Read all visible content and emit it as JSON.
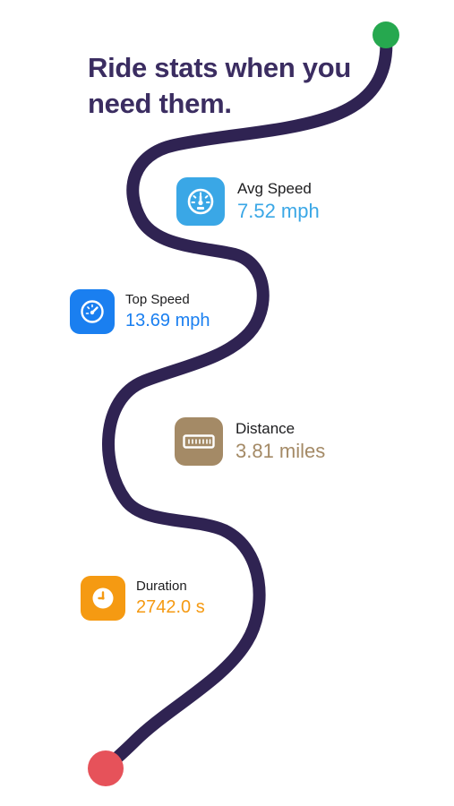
{
  "headline": "Ride stats when you need them.",
  "route": {
    "line_color": "#2f2352",
    "start_dot_color": "#26a84f",
    "end_dot_color": "#e6525a"
  },
  "stats": {
    "avg_speed": {
      "label": "Avg Speed",
      "value": "7.52 mph",
      "icon": "gauge-icon",
      "icon_color": "#3aa7e6",
      "value_color": "#3aa7e6"
    },
    "top_speed": {
      "label": "Top Speed",
      "value": "13.69 mph",
      "icon": "speedometer-icon",
      "icon_color": "#1a7ff0",
      "value_color": "#1a7ff0"
    },
    "distance": {
      "label": "Distance",
      "value": "3.81 miles",
      "icon": "ruler-icon",
      "icon_color": "#a48a66",
      "value_color": "#a48a66"
    },
    "duration": {
      "label": "Duration",
      "value": "2742.0 s",
      "icon": "clock-icon",
      "icon_color": "#f59a12",
      "value_color": "#f59a12"
    }
  }
}
